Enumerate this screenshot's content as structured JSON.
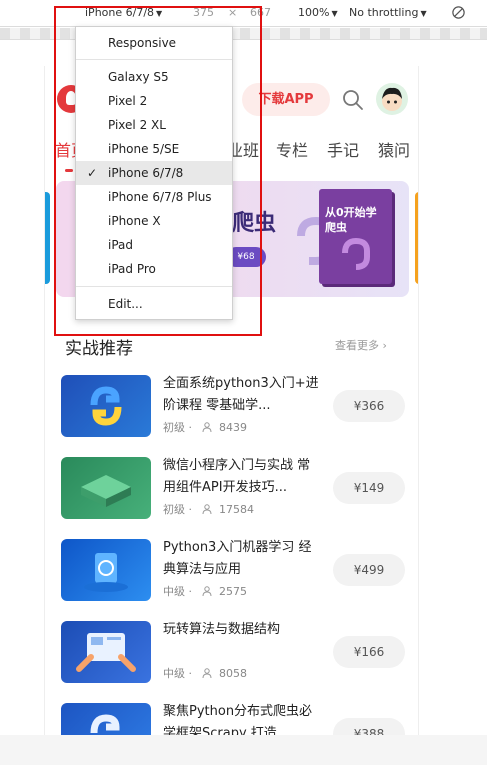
{
  "toolbar": {
    "device": "iPhone 6/7/8",
    "width": "375",
    "x": "×",
    "height": "667",
    "zoom": "100%",
    "throttle": "No throttling",
    "rotate_icon": "rotate-icon"
  },
  "menu": {
    "responsive": "Responsive",
    "devices": [
      "Galaxy S5",
      "Pixel 2",
      "Pixel 2 XL",
      "iPhone 5/SE",
      "iPhone 6/7/8",
      "iPhone 6/7/8 Plus",
      "iPhone X",
      "iPad",
      "iPad Pro"
    ],
    "selected_check": "✓",
    "edit": "Edit..."
  },
  "site": {
    "download_label": "下载APP",
    "nav": [
      "首页",
      "业班",
      "专栏",
      "手记",
      "猿问"
    ],
    "banner_text": "爬虫",
    "banner_price": "¥68",
    "book_title": "从0开始学爬虫",
    "section_title": "实战推荐",
    "more_label": "查看更多",
    "more_arrow": "›"
  },
  "courses": [
    {
      "title": "全面系统python3入门+进阶课程 零基础学...",
      "level": "初级",
      "dot": "·",
      "count": "8439",
      "price": "¥366"
    },
    {
      "title": "微信小程序入门与实战 常用组件API开发技巧...",
      "level": "初级",
      "dot": "·",
      "count": "17584",
      "price": "¥149"
    },
    {
      "title": "Python3入门机器学习 经典算法与应用",
      "level": "中级",
      "dot": "·",
      "count": "2575",
      "price": "¥499"
    },
    {
      "title": "玩转算法与数据结构",
      "level": "中级",
      "dot": "·",
      "count": "8058",
      "price": "¥166"
    },
    {
      "title": "聚焦Python分布式爬虫必学框架Scrapy 打造...",
      "level": "",
      "dot": "",
      "count": "",
      "price": "¥388"
    }
  ],
  "colors": {
    "accent": "#e4393c",
    "highlight": "#e01010"
  }
}
